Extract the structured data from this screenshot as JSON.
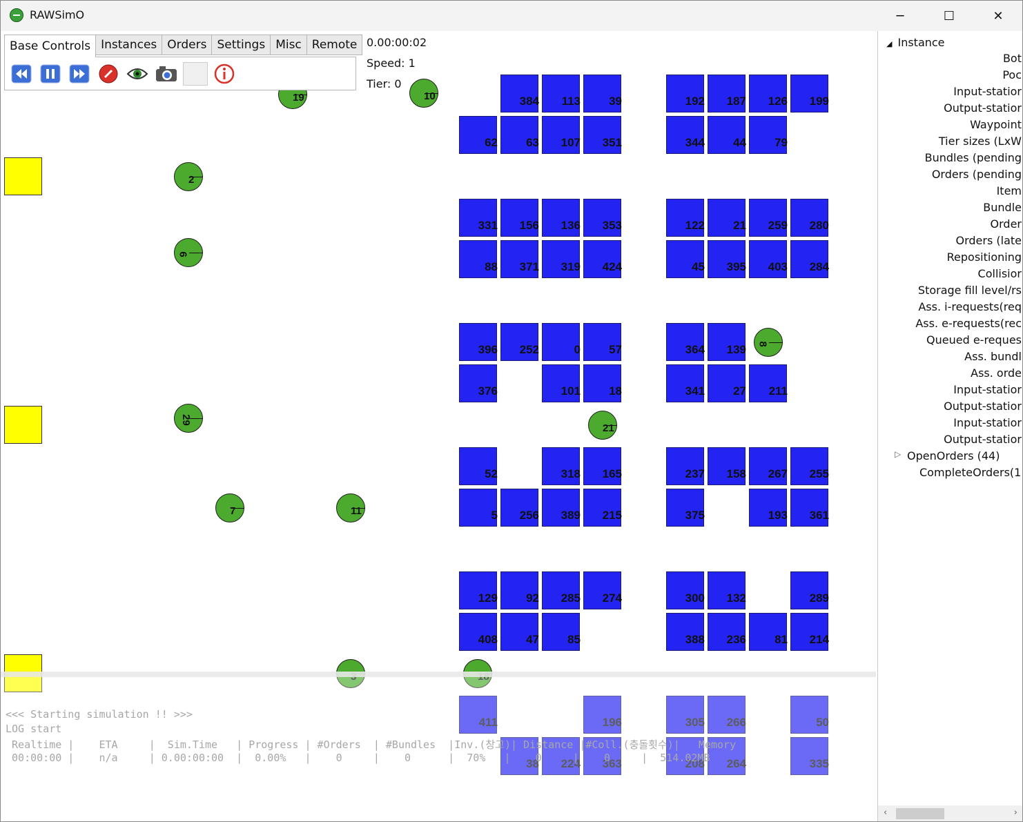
{
  "window": {
    "title": "RAWSimO",
    "minimize": "─",
    "maximize": "☐",
    "close": "✕"
  },
  "tabs": [
    "Base Controls",
    "Instances",
    "Orders",
    "Settings",
    "Misc",
    "Remote"
  ],
  "toolbar": {
    "icons": [
      "rewind-icon",
      "pause-icon",
      "fast-forward-icon",
      "stop-icon",
      "eye-icon",
      "camera-icon",
      "blank-button",
      "info-icon"
    ],
    "colors": {
      "blue_button": "#3b6fd6",
      "stop": "#d8322a",
      "info": "#d8322a"
    }
  },
  "status": {
    "time": "0.00:00:02",
    "speed": "Speed: 1",
    "tier": "Tier: 0"
  },
  "pods": [
    "384",
    "113",
    "39",
    "192",
    "187",
    "126",
    "199",
    "62",
    "63",
    "107",
    "351",
    "344",
    "44",
    "79",
    "331",
    "156",
    "136",
    "353",
    "122",
    "21",
    "259",
    "280",
    "88",
    "371",
    "319",
    "424",
    "45",
    "395",
    "403",
    "284",
    "396",
    "252",
    "0",
    "57",
    "364",
    "139",
    "376",
    "101",
    "18",
    "341",
    "27",
    "211",
    "52",
    "318",
    "165",
    "237",
    "158",
    "267",
    "255",
    "5",
    "256",
    "389",
    "215",
    "375",
    "193",
    "361",
    "129",
    "92",
    "285",
    "274",
    "300",
    "132",
    "289",
    "408",
    "47",
    "85",
    "388",
    "236",
    "81",
    "214",
    "411",
    "196",
    "305",
    "266",
    "50",
    "38",
    "224",
    "363",
    "208",
    "264",
    "335"
  ],
  "bots": [
    "19",
    "10",
    "2",
    "6",
    "8",
    "29",
    "21",
    "7",
    "11",
    "3",
    "18"
  ],
  "log": {
    "line1": "<<< Starting simulation !! >>>",
    "line2": "LOG start",
    "header": " Realtime |    ETA     |  Sim.Time   | Progress | #Orders  | #Bundles  |Inv.(창고)| Distance |#Coll.(충돌횟수)|   Memory",
    "values": " 00:00:00 |    n/a     | 0.00:00:00  |  0.00%   |    0     |    0      |  70%   |    0     |    0     |  514.02MB"
  },
  "panel": {
    "root": "Instance",
    "items": [
      "Bot",
      "Poc",
      "Input-statior",
      "Output-statior",
      "Waypoint",
      "Tier sizes (LxW",
      "Bundles (pending",
      "Orders (pending",
      "Item",
      "Bundle",
      "Order",
      "Orders (late",
      "Repositioning",
      "Collisior",
      "Storage fill level/rs",
      "Ass. i-requests(req",
      "Ass. e-requests(rec",
      "Queued e-reques",
      "Ass. bundl",
      "Ass. orde",
      "Input-statior",
      "Output-statior",
      "Input-statior",
      "Output-statior"
    ],
    "open_orders": "OpenOrders (44)",
    "complete_orders": "CompleteOrders(1"
  },
  "colors": {
    "pod": "#2424f2",
    "bot": "#4cab2e",
    "station": "#ffff00"
  }
}
